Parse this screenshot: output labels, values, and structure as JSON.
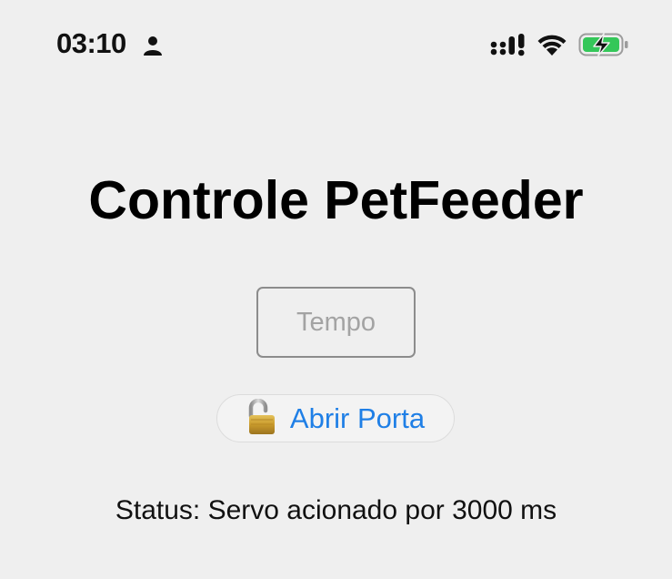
{
  "status_bar": {
    "time": "03:10",
    "icons": [
      "person-icon",
      "signal-icon",
      "wifi-icon",
      "battery-charging-icon"
    ],
    "battery_color": "#34c759"
  },
  "main": {
    "title": "Controle PetFeeder",
    "time_input": {
      "value": "",
      "placeholder": "Tempo"
    },
    "open_button": {
      "icon": "open-padlock-icon",
      "label": "Abrir Porta",
      "label_color": "#1f7fe6"
    },
    "status_label": "Status:",
    "status_text": "Servo acionado por 3000 ms"
  }
}
